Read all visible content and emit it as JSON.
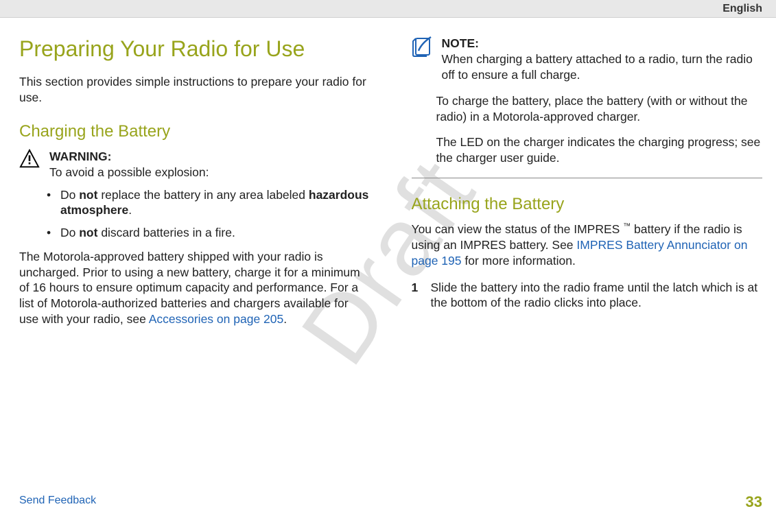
{
  "language": "English",
  "watermark": "Draft",
  "h1": "Preparing Your Radio for Use",
  "intro": "This section provides simple instructions to prepare your radio for use.",
  "h2_charging": "Charging the Battery",
  "warning": {
    "label": "WARNING:",
    "lead": "To avoid a possible explosion:",
    "bullets": {
      "b1_pre": "Do ",
      "b1_bold1": "not",
      "b1_mid": " replace the battery in any area labeled ",
      "b1_bold2": "hazardous atmosphere",
      "b1_post": ".",
      "b2_pre": "Do ",
      "b2_bold": "not",
      "b2_post": " discard batteries in a fire."
    }
  },
  "charging_para_pre": "The Motorola-approved battery shipped with your radio is uncharged. Prior to using a new battery, charge it for a minimum of 16 hours to ensure optimum capacity and performance. For a list of Motorola-authorized batteries and chargers available for use with your radio, see ",
  "charging_link": "Accessories on page 205",
  "charging_para_post": ".",
  "note": {
    "label": "NOTE:",
    "text": "When charging a battery attached to a radio, turn the radio off to ensure a full charge."
  },
  "charge_p1": "To charge the battery, place the battery (with or without the radio) in a Motorola-approved charger.",
  "charge_p2": "The LED on the charger indicates the charging progress; see the charger user guide.",
  "h2_attaching": "Attaching the Battery",
  "attach_pre": "You can view the status of the IMPRES ",
  "attach_tm": "™",
  "attach_mid": " battery if the radio is using an IMPRES battery. See ",
  "attach_link": "IMPRES Battery Annunciator on page 195",
  "attach_post": " for more information.",
  "step1_num": "1",
  "step1_text": "Slide the battery into the radio frame until the latch which is at the bottom of the radio clicks into place.",
  "footer": {
    "send": "Send Feedback",
    "page": "33"
  }
}
